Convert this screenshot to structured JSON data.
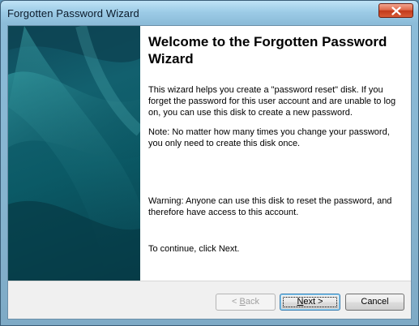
{
  "window": {
    "title": "Forgotten Password Wizard",
    "close_icon": "close-icon"
  },
  "content": {
    "heading": "Welcome to the Forgotten Password Wizard",
    "paragraphs": [
      "This wizard helps you create a \"password reset\" disk. If you forget the password for this user account and are unable to log on, you can use this disk to create a new password.",
      "Note: No matter how many times you change your password, you only need to create this disk once.",
      "Warning: Anyone can use this disk to reset the password, and therefore have access to this account.",
      "To continue, click Next."
    ]
  },
  "buttons": {
    "back": {
      "prefix": "< ",
      "mnemonic": "B",
      "rest": "ack",
      "enabled": false
    },
    "next": {
      "mnemonic": "N",
      "rest": "ext >",
      "default": true
    },
    "cancel": {
      "label": "Cancel"
    }
  },
  "colors": {
    "banner": "#0f4a5b",
    "close_button": "#c23a1c",
    "footer": "#f0f0f0"
  }
}
